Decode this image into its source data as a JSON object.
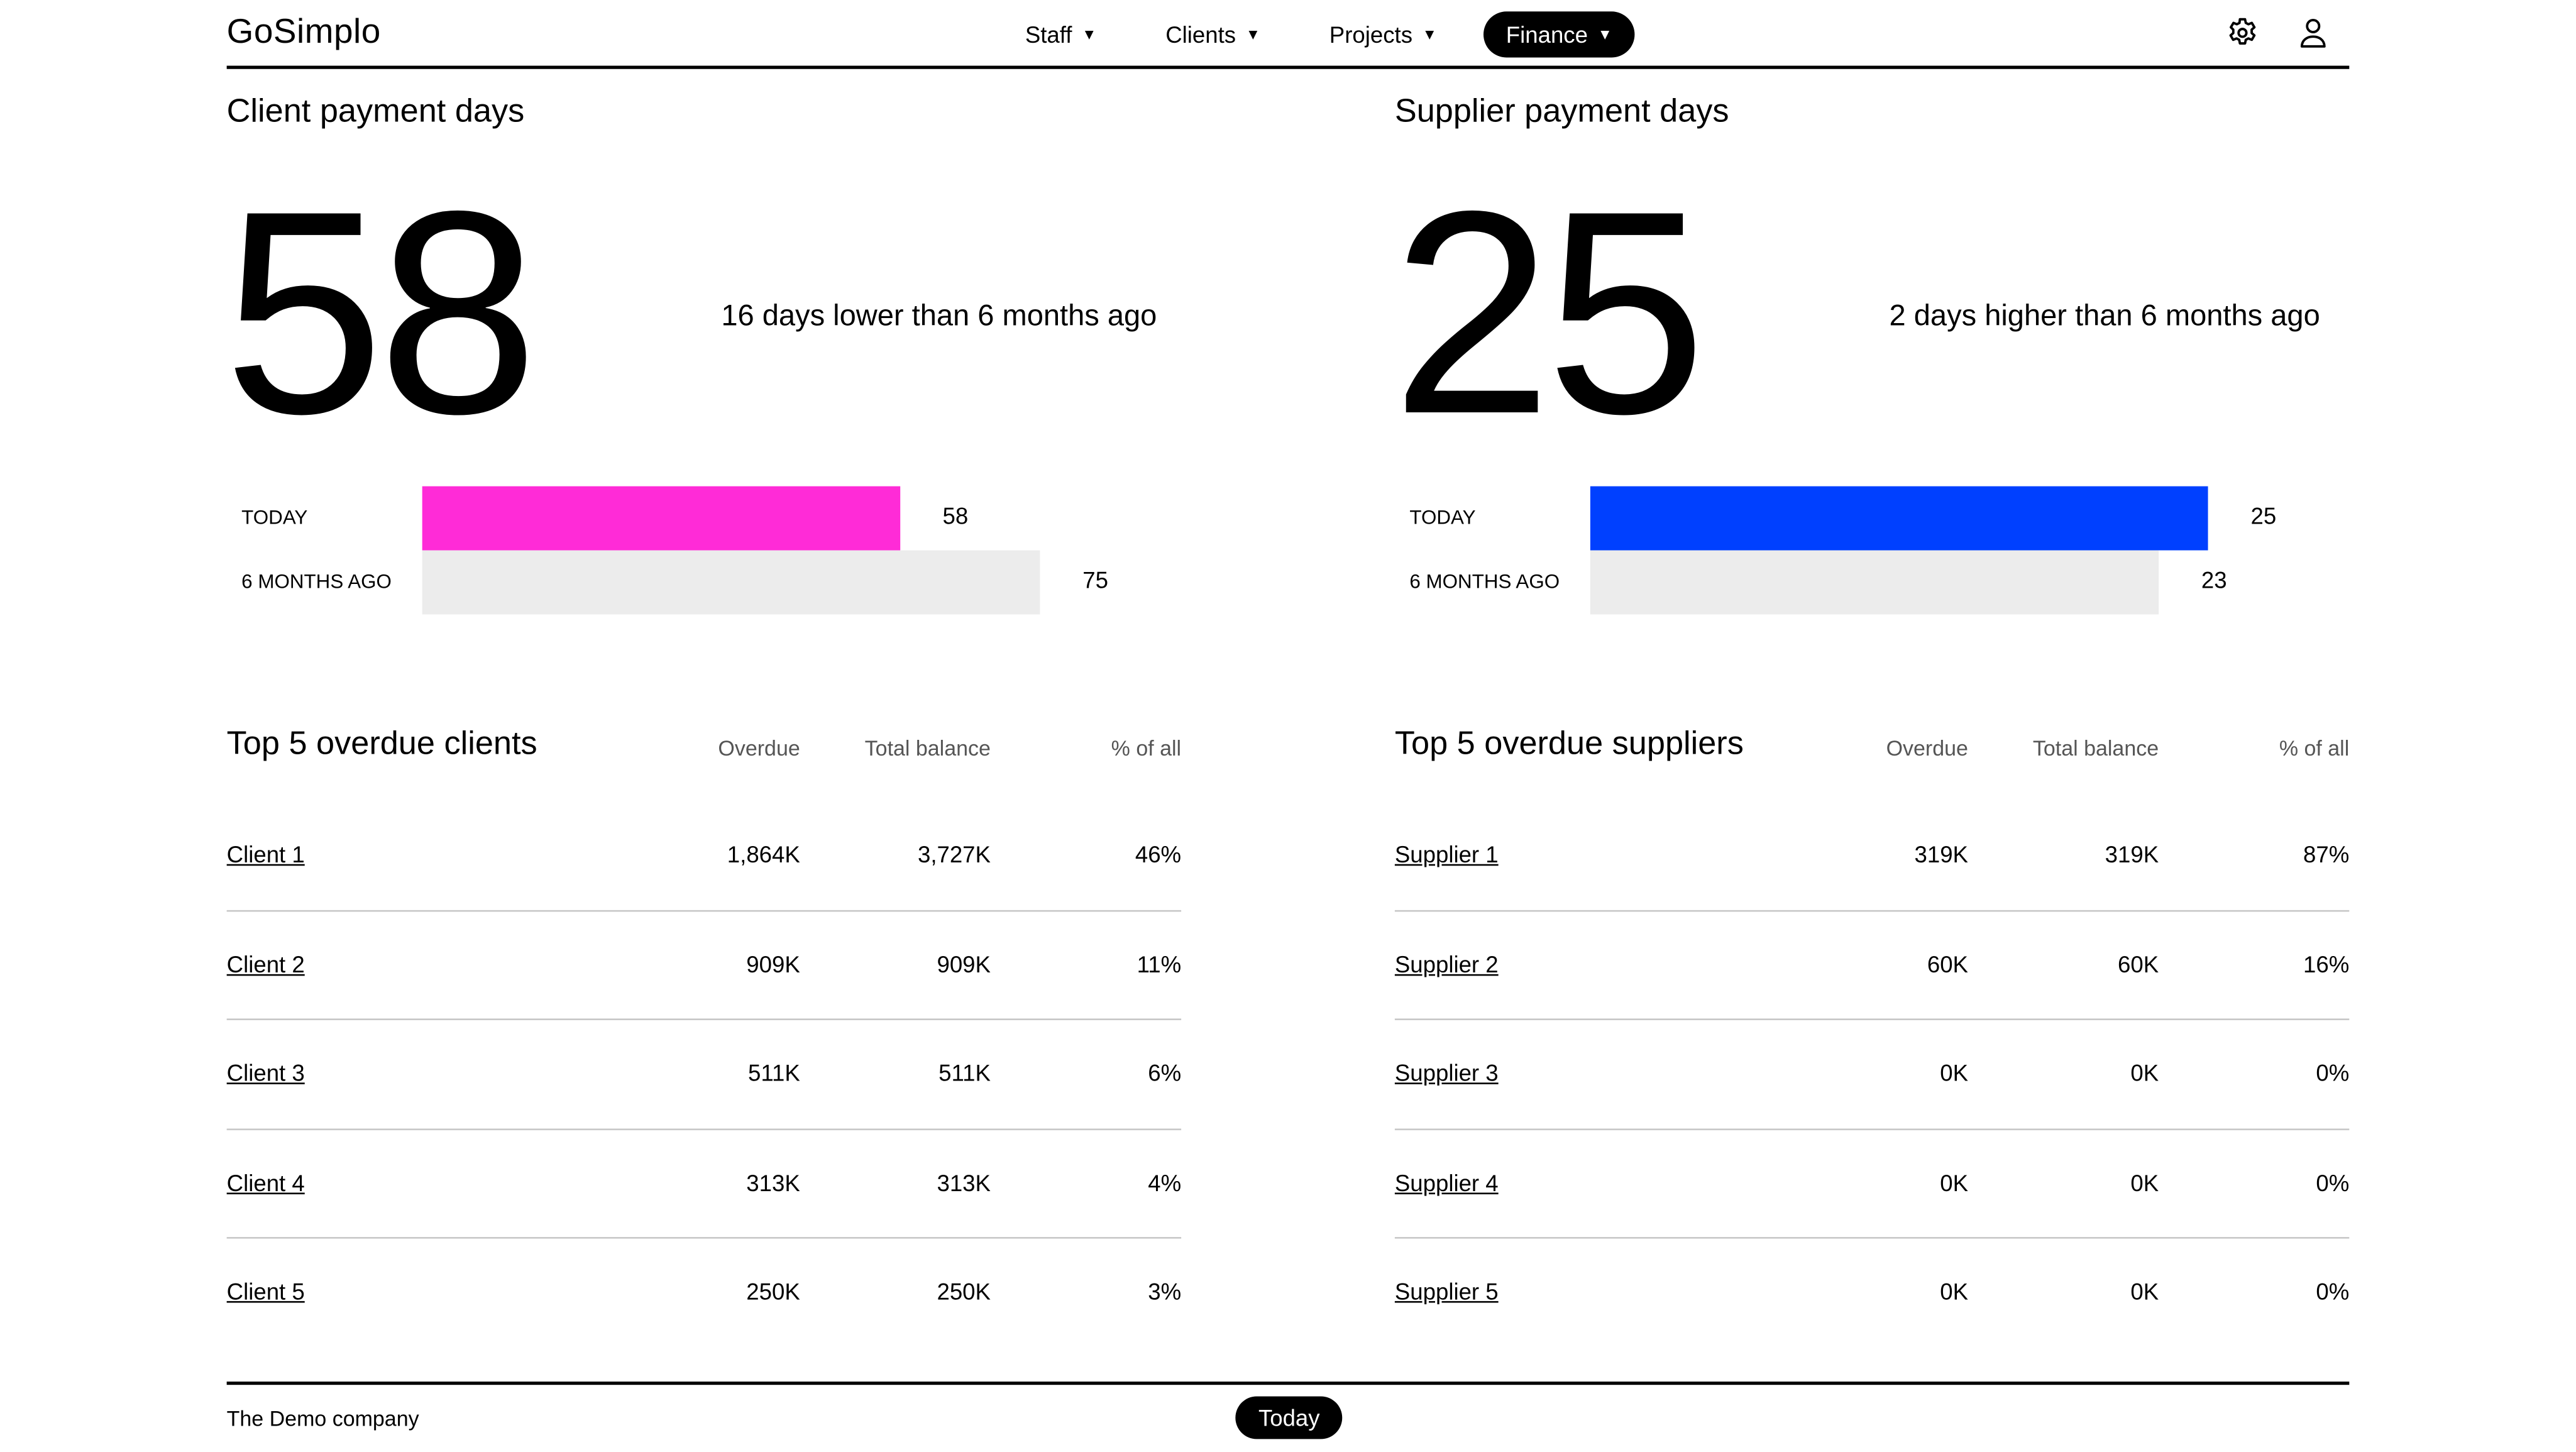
{
  "header": {
    "logo": "GoSimplo",
    "nav": [
      {
        "label": "Staff",
        "active": false
      },
      {
        "label": "Clients",
        "active": false
      },
      {
        "label": "Projects",
        "active": false
      },
      {
        "label": "Finance",
        "active": true
      }
    ],
    "icons": [
      "gear-icon",
      "user-icon"
    ]
  },
  "client_days": {
    "title": "Client payment days",
    "value": "58",
    "delta": "16 days lower than 6 months ago",
    "bars": [
      {
        "label": "TODAY",
        "value": 58,
        "display": "58",
        "color": "#ff2bd7"
      },
      {
        "label": "6 MONTHS AGO",
        "value": 75,
        "display": "75",
        "color": "#ececec"
      }
    ],
    "scale_max": 75
  },
  "supplier_days": {
    "title": "Supplier payment days",
    "value": "25",
    "delta": "2 days higher than 6 months ago",
    "bars": [
      {
        "label": "TODAY",
        "value": 25,
        "display": "25",
        "color": "#0040ff"
      },
      {
        "label": "6 MONTHS AGO",
        "value": 23,
        "display": "23",
        "color": "#ececec"
      }
    ],
    "scale_max": 25
  },
  "clients_table": {
    "title": "Top 5 overdue clients",
    "columns": [
      "Overdue",
      "Total balance",
      "% of all"
    ],
    "rows": [
      {
        "name": "Client 1",
        "overdue": "1,864K",
        "balance": "3,727K",
        "pct": "46%"
      },
      {
        "name": "Client 2",
        "overdue": "909K",
        "balance": "909K",
        "pct": "11%"
      },
      {
        "name": "Client 3",
        "overdue": "511K",
        "balance": "511K",
        "pct": "6%"
      },
      {
        "name": "Client 4",
        "overdue": "313K",
        "balance": "313K",
        "pct": "4%"
      },
      {
        "name": "Client 5",
        "overdue": "250K",
        "balance": "250K",
        "pct": "3%"
      }
    ]
  },
  "suppliers_table": {
    "title": "Top 5 overdue suppliers",
    "columns": [
      "Overdue",
      "Total balance",
      "% of all"
    ],
    "rows": [
      {
        "name": "Supplier 1",
        "overdue": "319K",
        "balance": "319K",
        "pct": "87%"
      },
      {
        "name": "Supplier 2",
        "overdue": "60K",
        "balance": "60K",
        "pct": "16%"
      },
      {
        "name": "Supplier 3",
        "overdue": "0K",
        "balance": "0K",
        "pct": "0%"
      },
      {
        "name": "Supplier 4",
        "overdue": "0K",
        "balance": "0K",
        "pct": "0%"
      },
      {
        "name": "Supplier 5",
        "overdue": "0K",
        "balance": "0K",
        "pct": "0%"
      }
    ]
  },
  "footer": {
    "company": "The Demo company",
    "today_button": "Today"
  }
}
